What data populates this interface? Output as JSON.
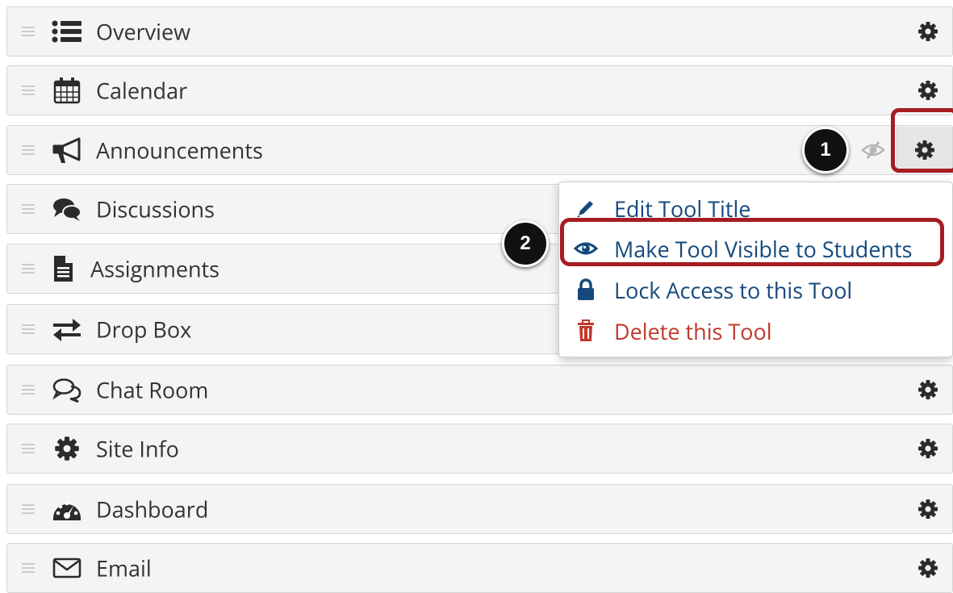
{
  "tools": [
    {
      "label": "Overview",
      "icon": "list-icon"
    },
    {
      "label": "Calendar",
      "icon": "calendar-icon"
    },
    {
      "label": "Announcements",
      "icon": "bullhorn-icon"
    },
    {
      "label": "Discussions",
      "icon": "comments-icon"
    },
    {
      "label": "Assignments",
      "icon": "file-text-icon"
    },
    {
      "label": "Drop Box",
      "icon": "exchange-icon"
    },
    {
      "label": "Chat Room",
      "icon": "chat-icon"
    },
    {
      "label": "Site Info",
      "icon": "gear-icon"
    },
    {
      "label": "Dashboard",
      "icon": "dashboard-icon"
    },
    {
      "label": "Email",
      "icon": "envelope-icon"
    }
  ],
  "menu": {
    "edit_title": "Edit Tool Title",
    "make_visible": "Make Tool Visible to Students",
    "lock_access": "Lock Access to this Tool",
    "delete_tool": "Delete this Tool"
  },
  "steps": {
    "one": "1",
    "two": "2"
  },
  "colors": {
    "link": "#15497c",
    "danger": "#c0392b",
    "highlight": "#a51d22",
    "row_bg": "#f4f4f4"
  }
}
